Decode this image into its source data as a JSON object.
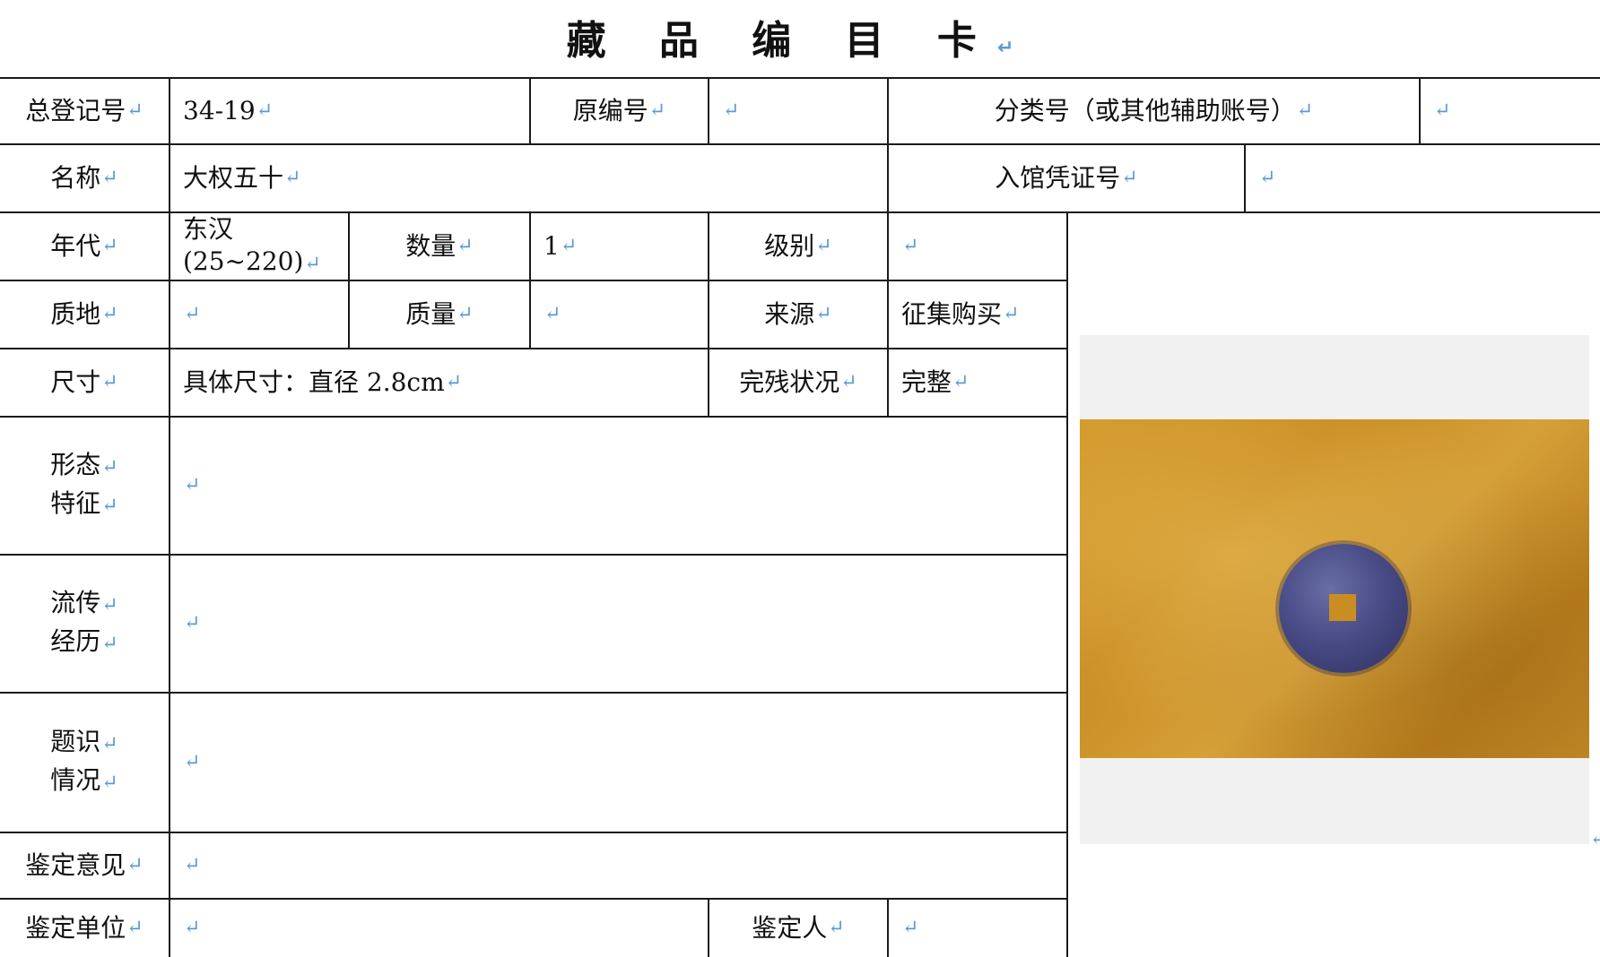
{
  "title": "藏 品 编 目 卡",
  "return_mark": "↵",
  "row1": {
    "reg_label": "总登记号",
    "reg_value": "34-19",
    "orig_label": "原编号",
    "orig_value": "",
    "class_label": "分类号（或其他辅助账号）",
    "class_value": ""
  },
  "row2": {
    "name_label": "名称",
    "name_value": "大权五十",
    "voucher_label": "入馆凭证号",
    "voucher_value": ""
  },
  "row3": {
    "era_label": "年代",
    "era_value_line1": "东汉",
    "era_value_line2": "(25~220)",
    "qty_label": "数量",
    "qty_value": "1",
    "grade_label": "级别",
    "grade_value": ""
  },
  "row4": {
    "material_label": "质地",
    "material_value": "",
    "mass_label": "质量",
    "mass_value": "",
    "source_label": "来源",
    "source_value": "征集购买"
  },
  "row5": {
    "size_label": "尺寸",
    "size_value": "具体尺寸：直径 2.8cm",
    "condition_label": "完残状况",
    "condition_value": "完整"
  },
  "row6": {
    "label_line1": "形态",
    "label_line2": "特征",
    "value": ""
  },
  "row7": {
    "label_line1": "流传",
    "label_line2": "经历",
    "value": ""
  },
  "row8": {
    "label_line1": "题识",
    "label_line2": "情况",
    "value": ""
  },
  "row9": {
    "label": "鉴定意见",
    "value": ""
  },
  "row10": {
    "unit_label": "鉴定单位",
    "unit_value": "",
    "appraiser_label": "鉴定人",
    "appraiser_value": ""
  },
  "colors": {
    "return_mark": "#5b9bd5",
    "rule": "#1a1a1a",
    "photo_bg": "#f1f1f1"
  },
  "icons": {
    "return_mark": "paragraph-return-icon"
  }
}
